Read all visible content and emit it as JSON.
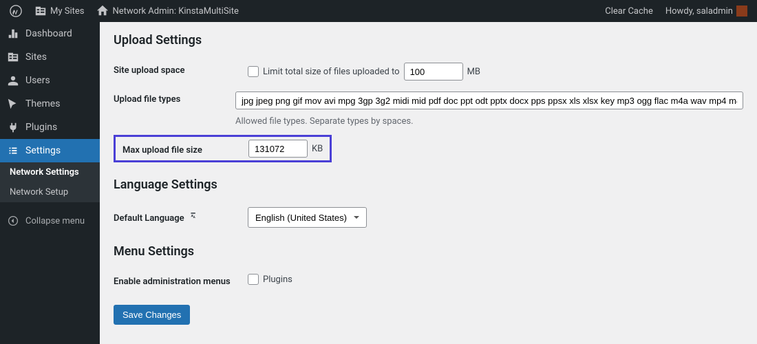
{
  "adminbar": {
    "my_sites": "My Sites",
    "network_admin": "Network Admin: KinstaMultiSite",
    "clear_cache": "Clear Cache",
    "howdy": "Howdy, saladmin"
  },
  "sidebar": {
    "dashboard": "Dashboard",
    "sites": "Sites",
    "users": "Users",
    "themes": "Themes",
    "plugins": "Plugins",
    "settings": "Settings",
    "network_settings": "Network Settings",
    "network_setup": "Network Setup",
    "collapse": "Collapse menu"
  },
  "sections": {
    "upload_settings": "Upload Settings",
    "language_settings": "Language Settings",
    "menu_settings": "Menu Settings"
  },
  "fields": {
    "site_upload_space_label": "Site upload space",
    "limit_total_label": "Limit total size of files uploaded to",
    "limit_total_value": "100",
    "limit_total_unit": "MB",
    "upload_file_types_label": "Upload file types",
    "upload_file_types_value": "jpg jpeg png gif mov avi mpg 3gp 3g2 midi mid pdf doc ppt odt pptx docx pps ppsx xls xlsx key mp3 ogg flac m4a wav mp4 m4",
    "upload_file_types_desc": "Allowed file types. Separate types by spaces.",
    "max_upload_label": "Max upload file size",
    "max_upload_value": "131072",
    "max_upload_unit": "KB",
    "default_language_label": "Default Language",
    "default_language_value": "English (United States)",
    "enable_admin_menus_label": "Enable administration menus",
    "plugins_checkbox_label": "Plugins"
  },
  "buttons": {
    "save": "Save Changes"
  }
}
